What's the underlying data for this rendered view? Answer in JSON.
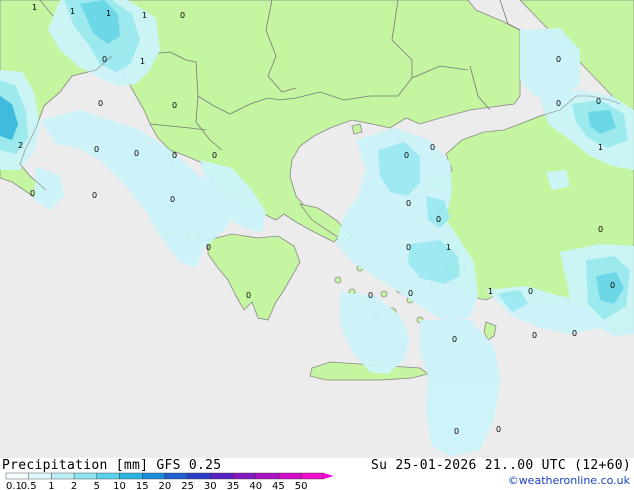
{
  "map": {
    "colors": {
      "sea": "#ececec",
      "land": "#c5f5a0",
      "precip_light": "#ccf4fa",
      "precip_mid": "#9ae9f3",
      "precip_heavy": "#68d6ea",
      "precip_heaviest": "#38b8e0",
      "border": "#777777"
    },
    "value_labels": [
      "1",
      "1",
      "1",
      "1",
      "0",
      "1",
      "0",
      "2",
      "0",
      "0",
      "0",
      "0",
      "0",
      "0",
      "0",
      "0",
      "0",
      "0",
      "0",
      "1",
      "0",
      "0",
      "0",
      "0",
      "1",
      "0",
      "0",
      "0",
      "0",
      "0",
      "0",
      "0",
      "0",
      "0",
      "1",
      "0",
      "0",
      "0",
      "0",
      "0"
    ]
  },
  "footer": {
    "title": "Precipitation [mm]  GFS 0.25",
    "valid": "Su 25-01-2026 21..00 UTC (12+60)",
    "credit": "©weatheronline.co.uk"
  },
  "colorbar": {
    "ticks": [
      "0.1",
      "0.5",
      "1",
      "2",
      "5",
      "10",
      "15",
      "20",
      "25",
      "30",
      "35",
      "40",
      "45",
      "50"
    ],
    "colors": [
      "#f4fdff",
      "#dcf7fb",
      "#bdeff7",
      "#8fe3f0",
      "#5cd0ea",
      "#2eb4e2",
      "#1a8cd8",
      "#1e5fd0",
      "#2b3fc6",
      "#5a22c2",
      "#8418c0",
      "#aa14c2",
      "#d010c8",
      "#f00cd0"
    ]
  }
}
